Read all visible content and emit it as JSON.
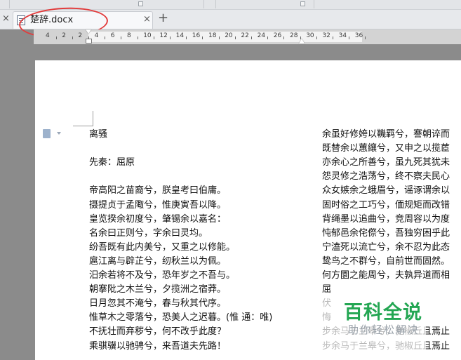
{
  "tab": {
    "title": "楚辞.docx",
    "close_glyph": "×",
    "new_tab_glyph": "+",
    "left_close_glyph": "×"
  },
  "ruler": {
    "numbers": [
      "4",
      "2",
      "2",
      "4",
      "6",
      "8",
      "10",
      "12",
      "14",
      "16",
      "18",
      "20",
      "22",
      "24",
      "26",
      "28",
      "30",
      "32",
      "34",
      "36"
    ]
  },
  "document": {
    "left_column": [
      "离骚",
      "",
      "先秦：屈原",
      "",
      "帝高阳之苗裔兮，朕皇考曰伯庸。",
      "摄提贞于孟陬兮，惟庚寅吾以降。",
      "皇览揆余初度兮，肇锡余以嘉名：",
      "名余曰正则兮，字余曰灵均。",
      "纷吾既有此内美兮，又重之以修能。",
      "扈江离与辟芷兮，纫秋兰以为佩。",
      "汨余若将不及兮，恐年岁之不吾与。",
      "朝搴阰之木兰兮，夕揽洲之宿莽。",
      "日月忽其不淹兮，春与秋其代序。",
      "惟草木之零落兮，恐美人之迟暮。(惟 通：唯)",
      "不抚壮而弃秽兮，何不改乎此度？",
      "乘骐骥以驰骋兮，来吾道夫先路！"
    ],
    "right_column": [
      "余虽好修姱以鞿羁兮，謇朝谇而",
      "既替余以蕙纕兮，又申之以揽茝",
      "亦余心之所善兮，虽九死其犹未",
      "怨灵修之浩荡兮，终不察夫民心",
      "众女嫉余之蛾眉兮，谣诼谓余以",
      "固时俗之工巧兮，偭规矩而改错",
      "背绳墨以追曲兮，竞周容以为度",
      "忳郁邑余侘傺兮，吾独穷困乎此",
      "宁溘死以流亡兮，余不忍为此态",
      "鸷鸟之不群兮，自前世而固然。",
      "何方圜之能周兮，夫孰异道而相",
      "屈",
      "伏",
      "悔",
      "步余马于兰皋兮，驰椒丘且焉止",
      "步余马于兰皋兮，驰椒丘且焉止"
    ]
  },
  "watermark": {
    "main": "百科全说",
    "sub": "助你轻松解决"
  },
  "colors": {
    "highlight": "#e23c3c",
    "watermark_green": "#23a652"
  }
}
